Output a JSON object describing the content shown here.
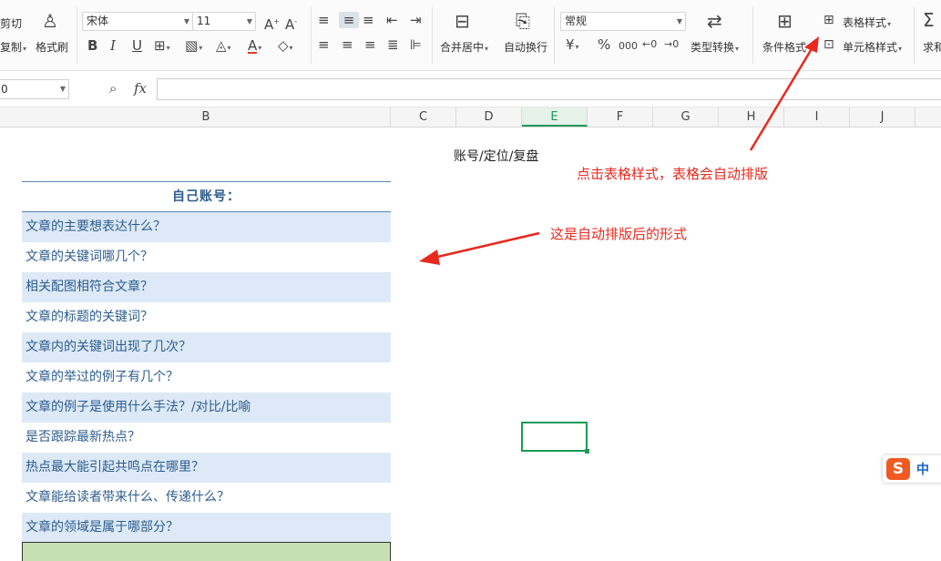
{
  "ribbon": {
    "cut_label": "剪切",
    "copy_label": "复制",
    "copy_caret": "▾",
    "format_painter_label": "格式刷",
    "font_name": "宋体",
    "font_size": "11",
    "bold": "B",
    "italic": "I",
    "underline": "U",
    "merge_center_label": "合并居中",
    "auto_wrap_label": "自动换行",
    "number_format": "常规",
    "currency_symbol": "¥",
    "percent_symbol": "%",
    "thousands_symbol": "000",
    "dec_inc": "⁺⁰₀₀",
    "dec_dec": "⁰₀₀",
    "type_convert_label": "类型转换",
    "cond_format_label": "条件格式",
    "table_style_label": "表格样式",
    "cell_style_label": "单元格样式",
    "sum_label": "求和"
  },
  "formula_bar": {
    "name_box": "0",
    "fx_label": "fx",
    "value": ""
  },
  "columns": [
    "B",
    "C",
    "D",
    "E",
    "F",
    "G",
    "H",
    "I",
    "J"
  ],
  "selected_column": "E",
  "sheet": {
    "header_cell": "账号/定位/复盘",
    "table_title": "自己账号：",
    "rows": [
      "文章的主要想表达什么？",
      "文章的关键词哪几个？",
      "相关配图相符合文章？",
      "文章的标题的关键词？",
      "文章内的关键词出现了几次？",
      "文章的举过的例子有几个？",
      "文章的例子是使用什么手法？/对比/比喻",
      "是否跟踪最新热点？",
      "热点最大能引起共鸣点在哪里？",
      "文章能给读者带来什么、传递什么？",
      "文章的领域是属于哪部分？"
    ]
  },
  "annotations": {
    "top": "点击表格样式，表格会自动排版",
    "middle": "这是自动排版后的形式"
  },
  "ime": {
    "logo": "S",
    "mode": "中"
  },
  "colors": {
    "accent_green": "#1d9a5a",
    "band_blue": "#dde9f6",
    "title_blue": "#2c5c8f",
    "annotation_red": "#e8291f",
    "green_cell": "#c6e0b4"
  }
}
